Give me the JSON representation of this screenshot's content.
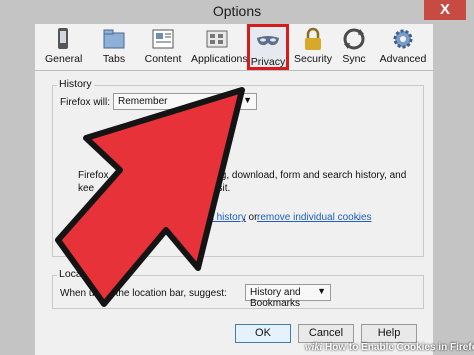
{
  "window": {
    "title": "Options",
    "close_glyph": "X"
  },
  "toolbar": {
    "tabs": [
      {
        "label": "General",
        "icon": "general-icon"
      },
      {
        "label": "Tabs",
        "icon": "tabs-icon"
      },
      {
        "label": "Content",
        "icon": "content-icon"
      },
      {
        "label": "Applications",
        "icon": "applications-icon"
      },
      {
        "label": "Privacy",
        "icon": "privacy-mask-icon",
        "selected": true
      },
      {
        "label": "Security",
        "icon": "lock-icon"
      },
      {
        "label": "Sync",
        "icon": "sync-icon"
      },
      {
        "label": "Advanced",
        "icon": "gear-icon"
      }
    ],
    "highlight_color": "#d61b1b"
  },
  "history": {
    "label": "History",
    "firefox_will": "Firefox will:",
    "select_value": "Remember",
    "desc_line1": "Firefox",
    "desc_line1_tail": "sing, download, form and search history, and",
    "desc_line2": "kee",
    "desc_line2_tail": "u visit.",
    "clear_prefix": "ant to",
    "clear_link": "recent history",
    "clear_mid": ", or",
    "remove_link": "remove individual cookies",
    "remove_end": "."
  },
  "location_bar": {
    "label": "Location Bar",
    "suggest_label": "When using the location bar, suggest:",
    "select_value": "History and Bookmarks"
  },
  "buttons": {
    "ok": "OK",
    "cancel": "Cancel",
    "help": "Help"
  },
  "watermark": {
    "brand": "wiki",
    "text": "How to Enable Cookies in Firefox"
  },
  "overlay_arrow_color": "#e8323a"
}
